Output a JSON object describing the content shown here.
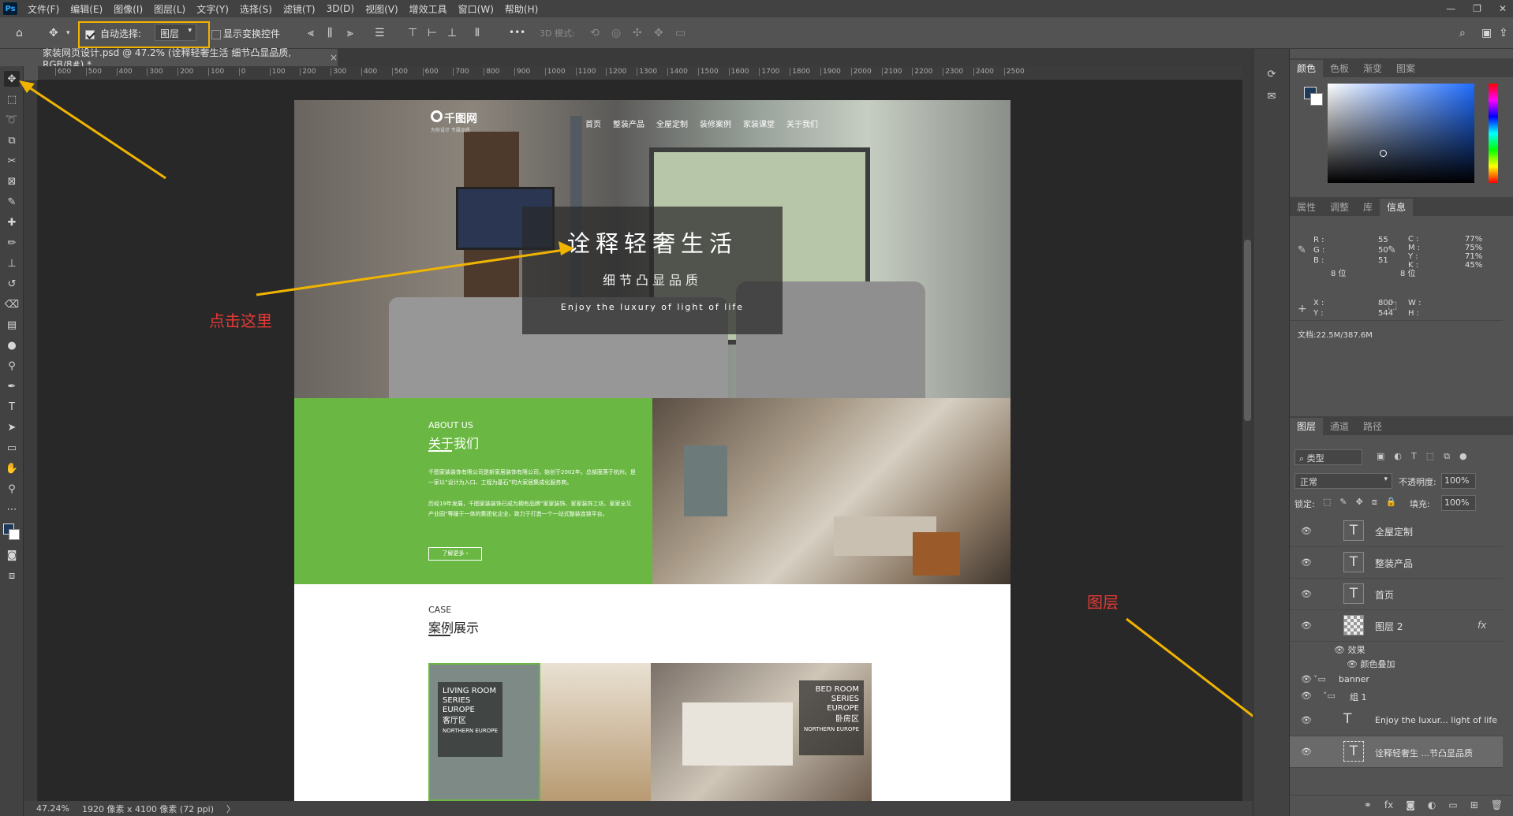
{
  "menubar": {
    "logo": "Ps",
    "items": [
      "文件(F)",
      "编辑(E)",
      "图像(I)",
      "图层(L)",
      "文字(Y)",
      "选择(S)",
      "滤镜(T)",
      "3D(D)",
      "视图(V)",
      "增效工具",
      "窗口(W)",
      "帮助(H)"
    ],
    "window_controls": [
      "—",
      "❐",
      "✕"
    ]
  },
  "options": {
    "autoselect_label": "自动选择:",
    "autoselect_value": "图层",
    "show_transform": "显示变换控件",
    "more": "•••",
    "mode3d": "3D 模式:"
  },
  "doc_tab": {
    "title": "家装网页设计.psd @ 47.2% (诠释轻奢生活 细节凸显品质, RGB/8#) *",
    "close": "×"
  },
  "ruler": {
    "ticks": [
      "600",
      "500",
      "400",
      "300",
      "200",
      "100",
      "0",
      "100",
      "200",
      "300",
      "400",
      "500",
      "600",
      "700",
      "800",
      "900",
      "1000",
      "1100",
      "1200",
      "1300",
      "1400",
      "1500",
      "1600",
      "1700",
      "1800",
      "1900",
      "2000",
      "2100",
      "2200",
      "2300",
      "2400",
      "2500"
    ]
  },
  "status": {
    "zoom": "47.24%",
    "size": "1920 像素 x 4100 像素 (72 ppi)",
    "arrow": "〉"
  },
  "design": {
    "logo": "千图网",
    "logo_sub": "为你设计 专属品质",
    "nav": [
      "首页",
      "整装产品",
      "全屋定制",
      "装修案例",
      "家装课堂",
      "关于我们"
    ],
    "headline": "诠释轻奢生活",
    "subhead": "细节凸显品质",
    "tagline": "Enjoy the luxury of light of life",
    "about_en": "ABOUT US",
    "about_cn": "关于我们",
    "about_p1": "千图家装装饰有限公司是新家居装饰有限公司，始创于2002年。总部面落于杭州。是一家以“设计为入口、工程为基石”的大家居集成化服务商。",
    "about_p2": "历经19年发展，千图家装装饰已成为拥有品牌“家家装饰、家家装饰工坊、家家全又产业园”等服于一体的集团化企业，致力于打造一个一站式整装连锁平台。",
    "about_btn": "了解更多 ›",
    "case_en": "CASE",
    "case_cn": "案例展示",
    "case1": {
      "l1": "LIVING ROOM",
      "l2": "SERIES",
      "l3": "EUROPE",
      "cn": "客厅区",
      "en": "NORTHERN EUROPE"
    },
    "case2": {
      "l1": "BED ROOM",
      "l2": "SERIES",
      "l3": "EUROPE",
      "cn": "卧房区",
      "en": "NORTHERN EUROPE"
    }
  },
  "annotations": {
    "click_here": "点击这里",
    "layers": "图层"
  },
  "panels": {
    "color_tabs": [
      "颜色",
      "色板",
      "渐变",
      "图案"
    ],
    "info_tabs": [
      "属性",
      "调整",
      "库",
      "信息"
    ],
    "info": {
      "r": "55",
      "g": "50",
      "b": "51",
      "c": "77%",
      "m": "75%",
      "y": "71%",
      "k": "45%",
      "bit1": "8 位",
      "bit2": "8 位",
      "x": "800",
      "y_val": "544",
      "w": "",
      "h": "",
      "doc": "文档:22.5M/387.6M",
      "labels": {
        "r": "R :",
        "g": "G :",
        "b": "B :",
        "c": "C :",
        "m": "M :",
        "y": "Y :",
        "k": "K :",
        "x": "X :",
        "ylab": "Y :",
        "w": "W :",
        "h": "H :"
      }
    },
    "layer_tabs": [
      "图层",
      "通道",
      "路径"
    ],
    "filter_label": "类型",
    "blend": "正常",
    "opacity_label": "不透明度:",
    "opacity": "100%",
    "lock_label": "锁定:",
    "fill_label": "填充:",
    "fill": "100%",
    "layers": [
      "全屋定制",
      "整装产品",
      "首页",
      "图层 2",
      "效果",
      "颜色叠加",
      "banner",
      "组 1",
      "Enjoy the luxur... light of life",
      "诠释轻奢生 ...节凸显品质"
    ],
    "fx": "fx"
  },
  "colors": {
    "accent": "#f0b400",
    "green": "#6ab843",
    "annotation": "#e53935",
    "fg_swatch": "#1e3a5a"
  }
}
